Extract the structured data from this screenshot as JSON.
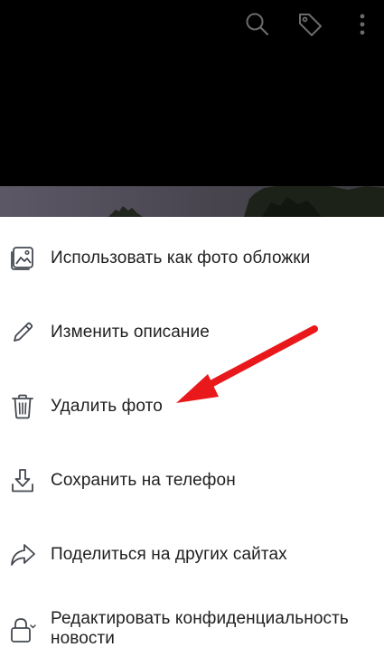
{
  "topbar": {
    "icons": [
      "search-icon",
      "tag-icon",
      "more-vertical-icon"
    ]
  },
  "menu": {
    "items": [
      {
        "label": "Использовать как фото обложки",
        "icon": "cover-photo-icon"
      },
      {
        "label": "Изменить описание",
        "icon": "pencil-icon"
      },
      {
        "label": "Удалить фото",
        "icon": "trash-icon"
      },
      {
        "label": "Сохранить на телефон",
        "icon": "download-icon"
      },
      {
        "label": "Поделиться на других сайтах",
        "icon": "share-icon"
      },
      {
        "label": "Редактировать конфиденциальность новости",
        "icon": "lock-icon"
      }
    ]
  },
  "colors": {
    "sheet_bg": "#ffffff",
    "text": "#1f1f1f",
    "icon": "#444950",
    "annotation_arrow": "#e8181b"
  }
}
